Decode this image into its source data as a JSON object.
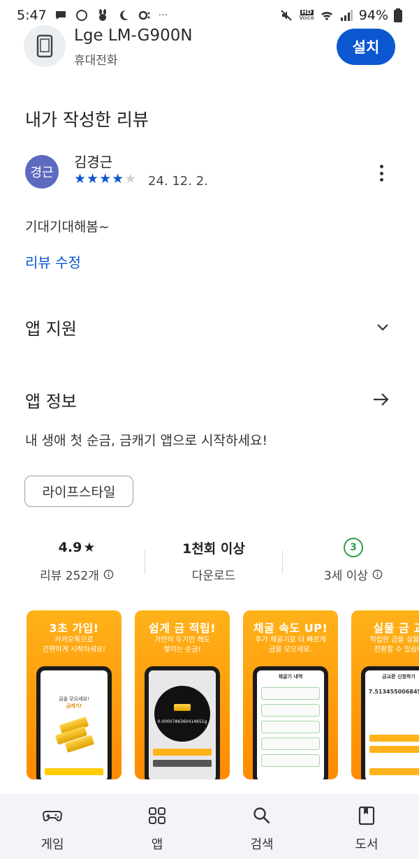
{
  "status_bar": {
    "time": "5:47",
    "battery": "94%",
    "hd_label": "HD",
    "voice_label": "Voice",
    "dots": "···"
  },
  "device": {
    "name": "Lge LM-G900N",
    "type": "휴대전화",
    "install_label": "설치",
    "icon": "phone-icon"
  },
  "review": {
    "heading": "내가 작성한 리뷰",
    "avatar_text": "경근",
    "reviewer": "김경근",
    "rating": 4,
    "max_rating": 5,
    "date": "24. 12. 2.",
    "text": "기대기대해봄~",
    "edit_label": "리뷰 수정"
  },
  "support": {
    "title": "앱 지원"
  },
  "app_info": {
    "title": "앱 정보",
    "description": "내 생애 첫 순금, 금캐기 앱으로 시작하세요!",
    "category": "라이프스타일"
  },
  "stats": {
    "rating": "4.9",
    "rating_star": "★",
    "reviews": "리뷰 252개",
    "downloads": "1천회 이상",
    "downloads_label": "다운로드",
    "age_badge": "3",
    "age_label": "3세 이상"
  },
  "screenshots": [
    {
      "title": "3초 가입!",
      "sub1": "카카오톡으로",
      "sub2": "간편하게 시작하세요!"
    },
    {
      "title": "쉽게 금 적립!",
      "sub1": "가만히 두기만 해도",
      "sub2": "쌓이는 순금!"
    },
    {
      "title": "채굴 속도 UP!",
      "sub1": "추가 채굴기로 더 빠르게",
      "sub2": "금을 모으세요."
    },
    {
      "title": "실물 금 교",
      "sub1": "적립한 금을 실물 금",
      "sub2": "전환할 수 있습니"
    }
  ],
  "screen_text": {
    "s1_line1": "금을 모으세요!",
    "s1_line2": "금캐기!",
    "s2_amount": "0.0000786360414651g",
    "s3_header": "채굴기 내역",
    "s4_header": "금교환 신청하기",
    "s4_amount": "7.51345500684546"
  },
  "bottom_nav": [
    {
      "label": "게임",
      "icon": "gamepad-icon"
    },
    {
      "label": "앱",
      "icon": "apps-grid-icon"
    },
    {
      "label": "검색",
      "icon": "search-icon"
    },
    {
      "label": "도서",
      "icon": "book-icon"
    }
  ],
  "colors": {
    "accent": "#0b57d0",
    "avatar": "#5c6bc0",
    "age_green": "#2e9e45",
    "screenshot_orange": "#ff9800"
  }
}
